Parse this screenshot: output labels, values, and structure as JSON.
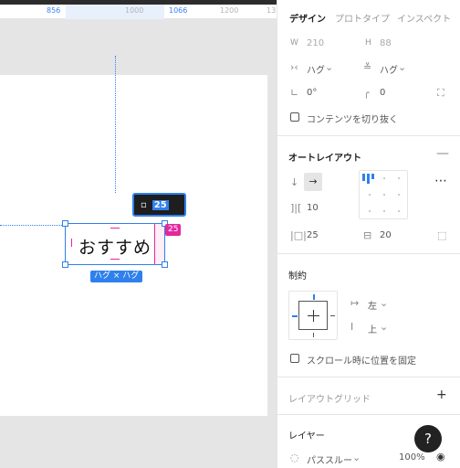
{
  "ruler": {
    "ticks": [
      "856",
      "1000",
      "1066",
      "1200",
      "13"
    ]
  },
  "canvas": {
    "text_layer": "おすすめ",
    "width_badge": "25",
    "size_badge": "ハグ × ハグ",
    "tooltip": {
      "icon": "padding-icon",
      "value": "25"
    }
  },
  "panel": {
    "tabs": [
      "デザイン",
      "プロトタイプ",
      "インスペクト"
    ],
    "w_label": "W",
    "w_value": "210",
    "h_label": "H",
    "h_value": "88",
    "hug_w": "ハグ",
    "hug_h": "ハグ",
    "rotation": "0°",
    "radius": "0",
    "clip_content": "コンテンツを切り抜く",
    "autolayout": {
      "title": "オートレイアウト",
      "spacing": "10",
      "padding_h": "25",
      "padding_v": "20"
    },
    "constraints": {
      "title": "制約",
      "horizontal": "左",
      "vertical": "上"
    },
    "fix_scroll": "スクロール時に位置を固定",
    "layout_grid": "レイアウトグリッド",
    "layer": {
      "title": "レイヤー",
      "blend": "パススルー",
      "opacity": "100%"
    },
    "help": "?"
  },
  "colors": {
    "accent": "#2f80ed",
    "pink": "#e3279d"
  }
}
